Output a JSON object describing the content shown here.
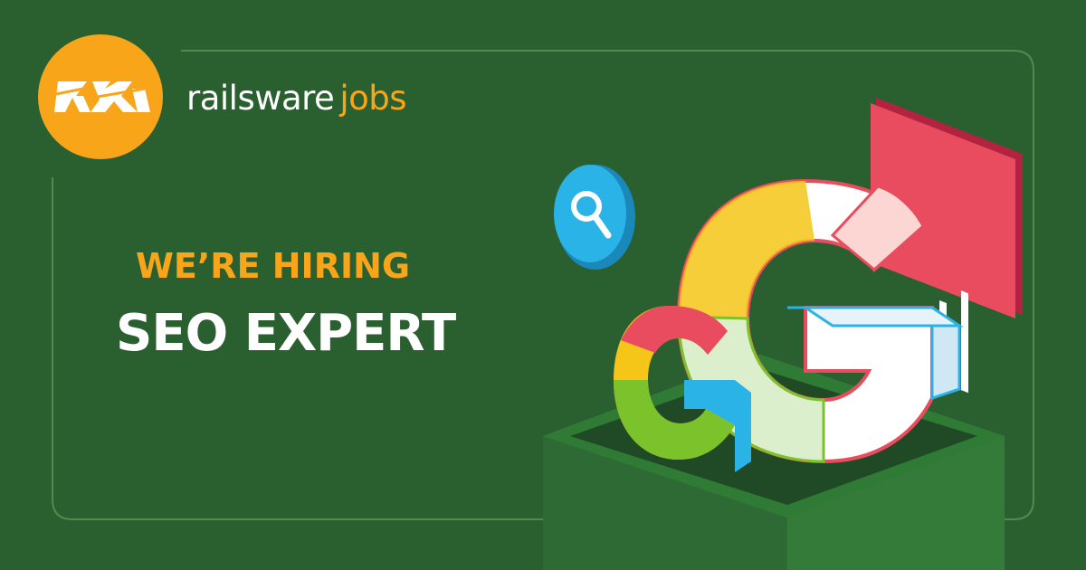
{
  "brand": {
    "name": "railsware",
    "suffix": "jobs",
    "logo_icon": "railsware-rw-logo-icon"
  },
  "headline": {
    "eyebrow": "WE’RE HIRING",
    "title": "SEO EXPERT"
  },
  "illustration": {
    "icons": [
      "search-icon",
      "bar-chart-icon",
      "google-g-logo-icon",
      "pedestal-box-icon"
    ]
  },
  "colors": {
    "background": "#2a6030",
    "frame_border": "#4f8a4f",
    "accent_orange": "#f9a51a",
    "text_white": "#ffffff",
    "g_red": "#e84c5e",
    "g_yellow": "#f5c518",
    "g_green": "#7cc22b",
    "g_blue": "#2ab3e6",
    "search_blue": "#2ab3e6",
    "pedestal_green": "#3c8a3e"
  }
}
